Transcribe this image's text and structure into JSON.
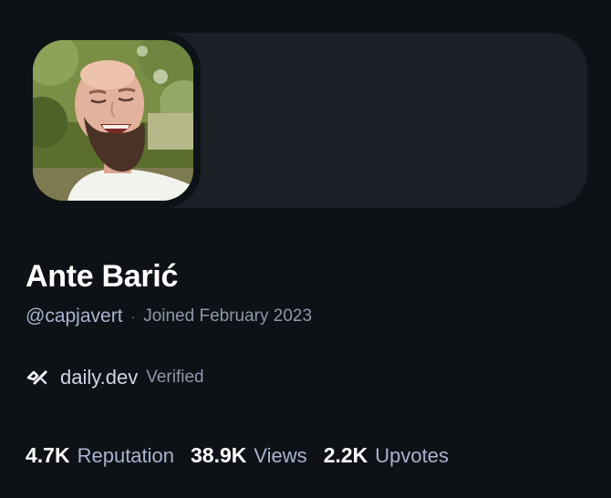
{
  "profile": {
    "name": "Ante Barić",
    "handle": "@capjavert",
    "separator": "·",
    "joined": "Joined February 2023",
    "avatar_icon": "user-avatar-photo"
  },
  "company": {
    "logo_icon": "daily-dev-logo-icon",
    "name": "daily.dev",
    "verified_label": "Verified"
  },
  "stats": [
    {
      "value": "4.7K",
      "label": "Reputation"
    },
    {
      "value": "38.9K",
      "label": "Views"
    },
    {
      "value": "2.2K",
      "label": "Upvotes"
    }
  ],
  "colors": {
    "background": "#0e1217",
    "cover": "#1c1f26",
    "secondary_text": "#a8b3cf",
    "tertiary_text": "#8f98ac"
  }
}
